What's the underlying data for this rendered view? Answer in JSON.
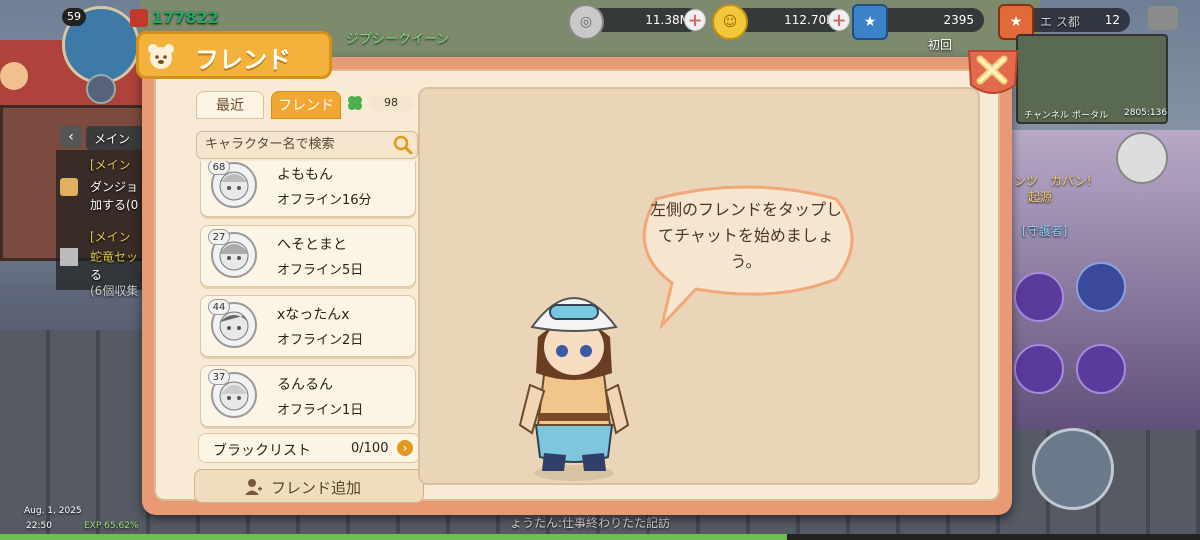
{
  "player": {
    "level": "59",
    "power": "177822"
  },
  "currency": [
    {
      "name": "silver",
      "icon": "silver-coin-icon",
      "value": "11.38M"
    },
    {
      "name": "gold",
      "icon": "gold-coin-icon",
      "value": "112.70K"
    },
    {
      "name": "star-ticket",
      "icon": "star-ticket-icon",
      "value": "2395"
    },
    {
      "name": "star-ticket-2",
      "icon": "star-ticket-icon",
      "value": "12"
    }
  ],
  "map": {
    "region": "エ ス都",
    "channel": "チャンネル",
    "portal": "ポータル",
    "coords": "2805:136"
  },
  "background": {
    "guild_name": "ジプシークイーン",
    "first_label": "初回",
    "quest_tab": "メイン",
    "quest1_tag": "[メイン",
    "quest1_line1": "ダンジョ",
    "quest1_line2": "加する(0",
    "quest2_tag": "[メイン",
    "quest2_line1": "蛇竜セッ",
    "quest2_line2": "る",
    "quest2_line3": "(6個収集",
    "right_text1": "ンツ　カバン!",
    "right_text2": "起源",
    "guardian_tag": "[守護者]",
    "chat_line": "ょうたん:仕事終わりたた記訪",
    "date": "Aug. 1, 2025",
    "time": "22:50",
    "exp": "EXP 65.62%"
  },
  "dialog": {
    "title": "フレンド",
    "tabs": [
      {
        "label": "最近",
        "active": false
      },
      {
        "label": "フレンド",
        "active": true
      }
    ],
    "friend_count": "98",
    "search_placeholder": "キャラクター名で検索",
    "friends": [
      {
        "level": "68",
        "name": "よももん",
        "status": "オフライン16分"
      },
      {
        "level": "27",
        "name": "へそとまと",
        "status": "オフライン5日"
      },
      {
        "level": "44",
        "name": "xなったんx",
        "status": "オフライン2日"
      },
      {
        "level": "37",
        "name": "るんるん",
        "status": "オフライン1日"
      }
    ],
    "blacklist_label": "ブラックリスト",
    "blacklist_count": "0/100",
    "add_friend_label": "フレンド追加",
    "hint_text": "左側のフレンドをタップしてチャットを始めましょう。"
  },
  "colors": {
    "accent": "#f3a733",
    "panel": "#f8ead4",
    "frame": "#e79a74",
    "close": "#f0b237"
  }
}
